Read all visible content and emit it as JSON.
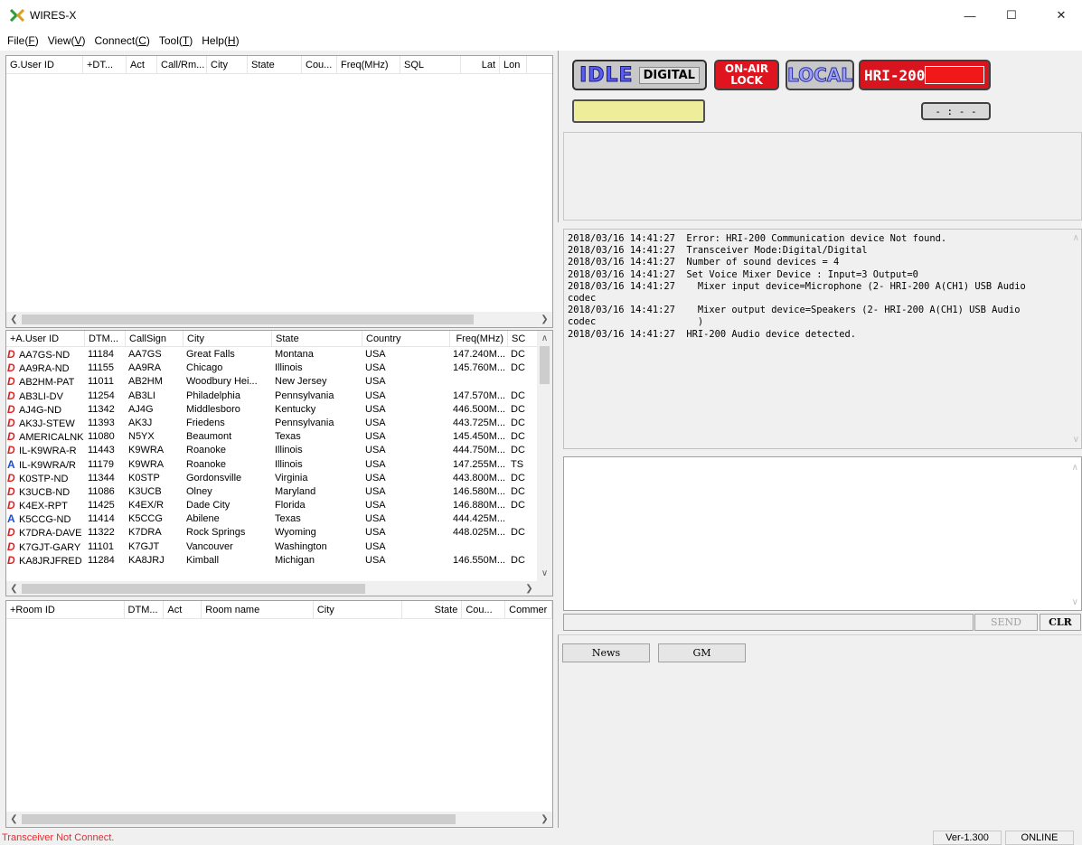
{
  "window": {
    "title": "WIRES-X",
    "minimize": "—",
    "maximize": "☐",
    "close": "✕"
  },
  "menu": [
    {
      "label": "File(",
      "key": "F",
      "end": ")"
    },
    {
      "label": "View(",
      "key": "V",
      "end": ")"
    },
    {
      "label": "Connect(",
      "key": "C",
      "end": ")"
    },
    {
      "label": "Tool(",
      "key": "T",
      "end": ")"
    },
    {
      "label": "Help(",
      "key": "H",
      "end": ")"
    }
  ],
  "group_list": {
    "columns": [
      "G.User ID",
      "+DT...",
      "Act",
      "Call/Rm...",
      "City",
      "State",
      "Cou...",
      "Freq(MHz)",
      "SQL",
      "Lat",
      "Lon"
    ]
  },
  "user_list": {
    "columns": [
      "+A.User ID",
      "DTM...",
      "CallSign",
      "City",
      "State",
      "Country",
      "Freq(MHz)",
      "SC"
    ],
    "rows": [
      {
        "icon": "D",
        "id": "AA7GS-ND",
        "dtmf": "11184",
        "call": "AA7GS",
        "city": "Great Falls",
        "state": "Montana",
        "country": "USA",
        "freq": "147.240M...",
        "sc": "DC"
      },
      {
        "icon": "D",
        "id": "AA9RA-ND",
        "dtmf": "11155",
        "call": "AA9RA",
        "city": "Chicago",
        "state": "Illinois",
        "country": "USA",
        "freq": "145.760M...",
        "sc": "DC"
      },
      {
        "icon": "D",
        "id": "AB2HM-PAT",
        "dtmf": "11011",
        "call": "AB2HM",
        "city": "Woodbury Hei...",
        "state": "New Jersey",
        "country": "USA",
        "freq": "",
        "sc": ""
      },
      {
        "icon": "D",
        "id": "AB3LI-DV",
        "dtmf": "11254",
        "call": "AB3LI",
        "city": "Philadelphia",
        "state": "Pennsylvania",
        "country": "USA",
        "freq": "147.570M...",
        "sc": "DC"
      },
      {
        "icon": "D",
        "id": "AJ4G-ND",
        "dtmf": "11342",
        "call": "AJ4G",
        "city": "Middlesboro",
        "state": "Kentucky",
        "country": "USA",
        "freq": "446.500M...",
        "sc": "DC"
      },
      {
        "icon": "D",
        "id": "AK3J-STEW",
        "dtmf": "11393",
        "call": "AK3J",
        "city": "Friedens",
        "state": "Pennsylvania",
        "country": "USA",
        "freq": "443.725M...",
        "sc": "DC"
      },
      {
        "icon": "D",
        "id": "AMERICALNK",
        "dtmf": "11080",
        "call": "N5YX",
        "city": "Beaumont",
        "state": "Texas",
        "country": "USA",
        "freq": "145.450M...",
        "sc": "DC"
      },
      {
        "icon": "D",
        "id": "IL-K9WRA-R",
        "dtmf": "11443",
        "call": "K9WRA",
        "city": "Roanoke",
        "state": "Illinois",
        "country": "USA",
        "freq": "444.750M...",
        "sc": "DC"
      },
      {
        "icon": "A",
        "id": "IL-K9WRA/R",
        "dtmf": "11179",
        "call": "K9WRA",
        "city": "Roanoke",
        "state": "Illinois",
        "country": "USA",
        "freq": "147.255M...",
        "sc": "TS"
      },
      {
        "icon": "D",
        "id": "K0STP-ND",
        "dtmf": "11344",
        "call": "K0STP",
        "city": "Gordonsville",
        "state": "Virginia",
        "country": "USA",
        "freq": "443.800M...",
        "sc": "DC"
      },
      {
        "icon": "D",
        "id": "K3UCB-ND",
        "dtmf": "11086",
        "call": "K3UCB",
        "city": "Olney",
        "state": "Maryland",
        "country": "USA",
        "freq": "146.580M...",
        "sc": "DC"
      },
      {
        "icon": "D",
        "id": "K4EX-RPT",
        "dtmf": "11425",
        "call": "K4EX/R",
        "city": "Dade City",
        "state": "Florida",
        "country": "USA",
        "freq": "146.880M...",
        "sc": "DC"
      },
      {
        "icon": "A",
        "id": "K5CCG-ND",
        "dtmf": "11414",
        "call": "K5CCG",
        "city": "Abilene",
        "state": "Texas",
        "country": "USA",
        "freq": "444.425M...",
        "sc": ""
      },
      {
        "icon": "D",
        "id": "K7DRA-DAVE",
        "dtmf": "11322",
        "call": "K7DRA",
        "city": "Rock Springs",
        "state": "Wyoming",
        "country": "USA",
        "freq": "448.025M...",
        "sc": "DC"
      },
      {
        "icon": "D",
        "id": "K7GJT-GARY",
        "dtmf": "11101",
        "call": "K7GJT",
        "city": "Vancouver",
        "state": "Washington",
        "country": "USA",
        "freq": "",
        "sc": ""
      },
      {
        "icon": "D",
        "id": "KA8JRJFRED",
        "dtmf": "11284",
        "call": "KA8JRJ",
        "city": "Kimball",
        "state": "Michigan",
        "country": "USA",
        "freq": "146.550M...",
        "sc": "DC"
      }
    ]
  },
  "room_list": {
    "columns": [
      "+Room ID",
      "DTM...",
      "Act",
      "Room name",
      "City",
      "State",
      "Cou...",
      "Commer"
    ]
  },
  "status_panel": {
    "idle": "IDLE",
    "digital": "DIGITAL",
    "onair_line1": "ON-AIR",
    "onair_line2": "LOCK",
    "local": "LOCAL",
    "device": "HRI-200",
    "timer": "- : - -"
  },
  "log": [
    "2018/03/16 14:41:27  Error: HRI-200 Communication device Not found.",
    "2018/03/16 14:41:27  Transceiver Mode:Digital/Digital",
    "2018/03/16 14:41:27  Number of sound devices = 4",
    "2018/03/16 14:41:27  Set Voice Mixer Device : Input=3 Output=0",
    "2018/03/16 14:41:27    Mixer input device=Microphone (2- HRI-200 A(CH1) USB Audio",
    "codec",
    "2018/03/16 14:41:27    Mixer output device=Speakers (2- HRI-200 A(CH1) USB Audio",
    "codec                  )",
    "2018/03/16 14:41:27  HRI-200 Audio device detected."
  ],
  "message": {
    "send": "SEND",
    "clr": "CLR"
  },
  "tabs": {
    "news": "News",
    "gm": "GM"
  },
  "statusbar": {
    "left": "Transceiver Not Connect.",
    "version": "Ver-1.300",
    "online": "ONLINE"
  },
  "colors": {
    "status_error": "#e03030",
    "onair_red": "#e0141e",
    "hri_red": "#d8141e",
    "local_blue": "#6a6fd8",
    "yellow_box": "#eded9a"
  }
}
